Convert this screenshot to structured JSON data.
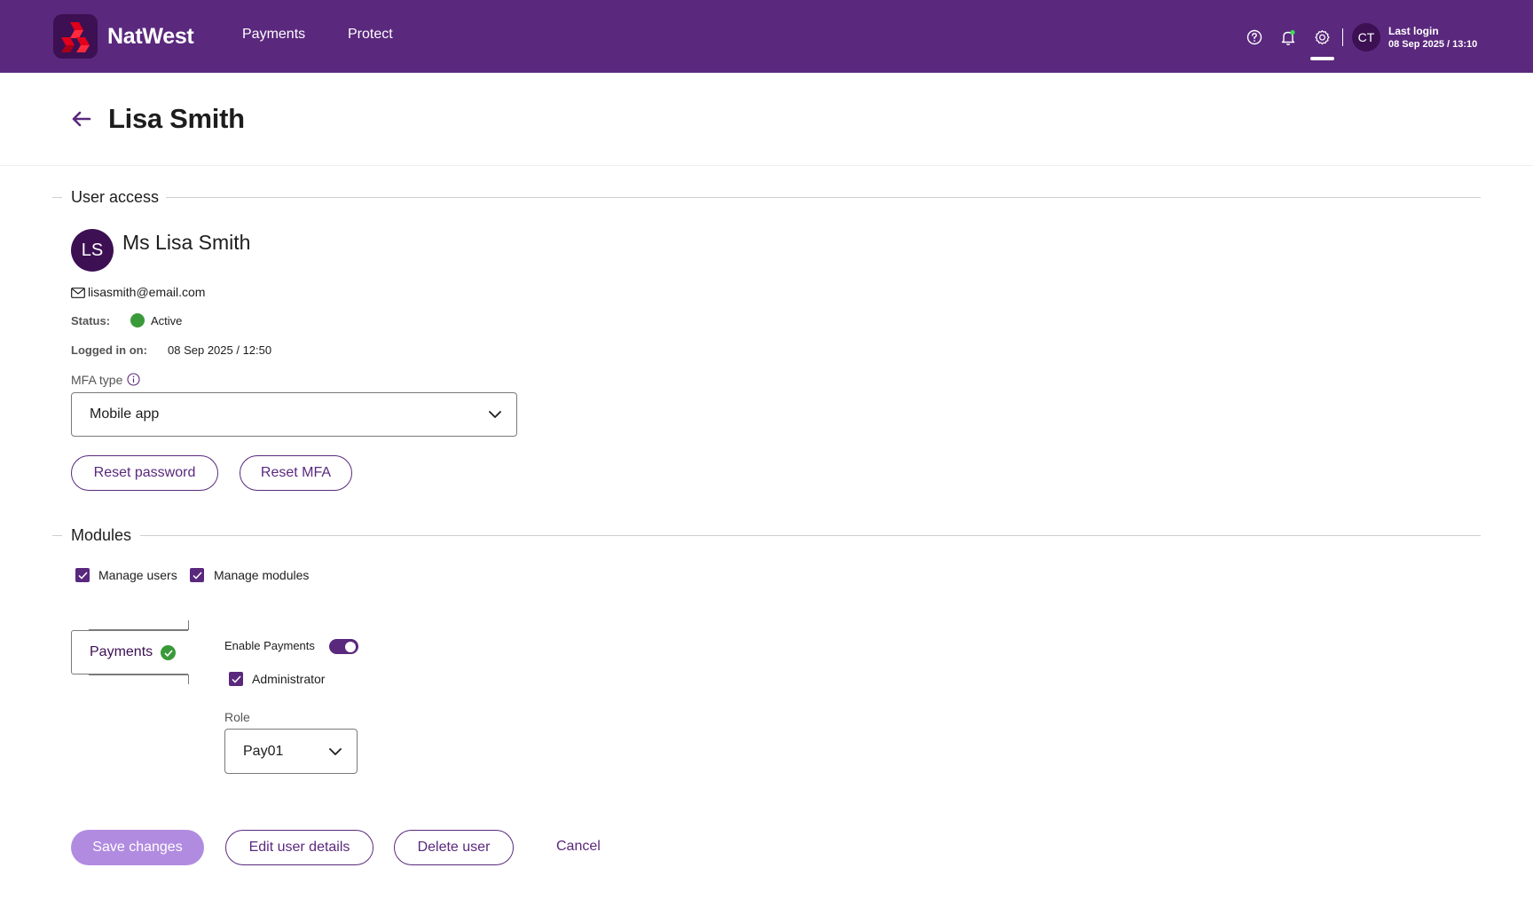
{
  "header": {
    "brand": "NatWest",
    "nav": [
      "Payments",
      "Protect"
    ],
    "user_initials": "CT",
    "last_login_label": "Last login",
    "last_login_value": "08 Sep 2025 / 13:10"
  },
  "page": {
    "title": "Lisa Smith"
  },
  "user_access": {
    "section_title": "User access",
    "avatar_initials": "LS",
    "full_name": "Ms Lisa Smith",
    "email": "lisasmith@email.com",
    "status_label": "Status:",
    "status_value": "Active",
    "status_color": "#3a9a3a",
    "logged_in_label": "Logged in on:",
    "logged_in_value": "08 Sep 2025 / 12:50",
    "mfa_label": "MFA type",
    "mfa_value": "Mobile app",
    "reset_password": "Reset password",
    "reset_mfa": "Reset MFA"
  },
  "modules": {
    "section_title": "Modules",
    "permissions": [
      {
        "label": "Manage users",
        "checked": true
      },
      {
        "label": "Manage modules",
        "checked": true
      }
    ],
    "payments": {
      "tab_label": "Payments",
      "enable_label": "Enable Payments",
      "enabled": true,
      "administrator_label": "Administrator",
      "administrator_checked": true,
      "role_label": "Role",
      "role_value": "Pay01"
    }
  },
  "actions": {
    "save": "Save changes",
    "edit": "Edit user details",
    "delete": "Delete user",
    "cancel": "Cancel"
  },
  "colors": {
    "brand": "#5a287d",
    "brand_dark": "#3c1053",
    "logo_red": "#e0001b",
    "success": "#3a9a3a",
    "disabled_primary": "#b18be0"
  }
}
